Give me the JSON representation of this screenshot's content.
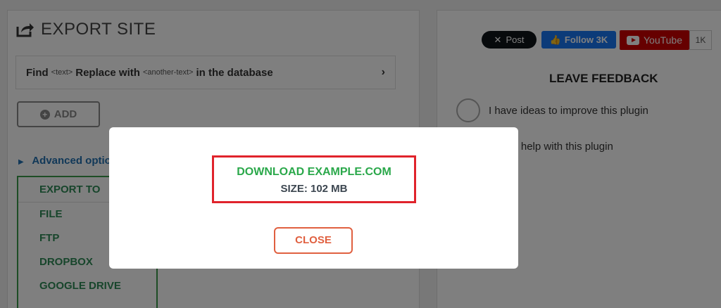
{
  "export": {
    "title": "EXPORT SITE",
    "find_label": "Find",
    "find_placeholder": "<text>",
    "replace_label": "Replace with",
    "replace_placeholder": "<another-text>",
    "suffix": "in the database",
    "add_label": "ADD",
    "advanced_label": "Advanced options",
    "export_to": {
      "heading": "EXPORT TO",
      "options": [
        "FILE",
        "FTP",
        "DROPBOX",
        "GOOGLE DRIVE"
      ]
    }
  },
  "social": {
    "x_post": "Post",
    "facebook": "Follow 3K",
    "youtube": "YouTube",
    "youtube_count": "1K"
  },
  "feedback": {
    "title": "LEAVE FEEDBACK",
    "option_1": "I have ideas to improve this plugin",
    "option_2": "I need help with this plugin"
  },
  "modal": {
    "download_label": "DOWNLOAD EXAMPLE.COM",
    "size_label": "SIZE: 102 MB",
    "close_label": "CLOSE"
  },
  "colors": {
    "accent_green": "#2aa84a",
    "highlight_red": "#e0232b",
    "close_orange": "#e06040",
    "link_blue": "#2271b1"
  }
}
